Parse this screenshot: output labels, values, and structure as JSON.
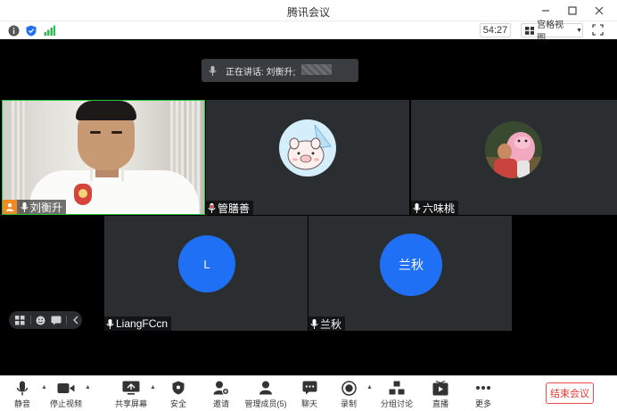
{
  "window": {
    "title": "腾讯会议",
    "minimize_icon": "minimize-icon",
    "maximize_icon": "maximize-icon",
    "close_icon": "close-icon"
  },
  "infobar": {
    "icons": [
      "info-icon",
      "shield-icon",
      "signal-icon"
    ],
    "timer": "54:27",
    "view_mode": "宫格视图",
    "fullscreen_icon": "fullscreen-icon"
  },
  "speaker_banner": {
    "label": "正在讲话: 刘衡升;"
  },
  "participants": [
    {
      "name": "刘衡升",
      "type": "video",
      "active": true,
      "host": true
    },
    {
      "name": "管膳善",
      "type": "avatar-image",
      "avatar": "pig-cartoon"
    },
    {
      "name": "六味桃",
      "type": "avatar-image",
      "avatar": "pig-photo"
    },
    {
      "name": "LiangFCcn",
      "type": "avatar-letter",
      "letter": "L"
    },
    {
      "name": "兰秋",
      "type": "avatar-letter",
      "letter": "兰秋"
    }
  ],
  "floating_controls": [
    "grid-icon",
    "emoji-icon",
    "chat-icon",
    "collapse-icon"
  ],
  "toolbar": {
    "mute": "静音",
    "stop_video": "停止视频",
    "share_screen": "共享屏幕",
    "security": "安全",
    "invite": "邀请",
    "manage_members": "管理成员(5)",
    "chat": "聊天",
    "record": "录制",
    "breakout": "分组讨论",
    "live": "直播",
    "more": "更多",
    "end_meeting": "结束会议"
  },
  "colors": {
    "accent": "#1f70f5",
    "active_border": "#27c13b",
    "end_red": "#e53935",
    "tile_bg": "#2b2e31"
  }
}
